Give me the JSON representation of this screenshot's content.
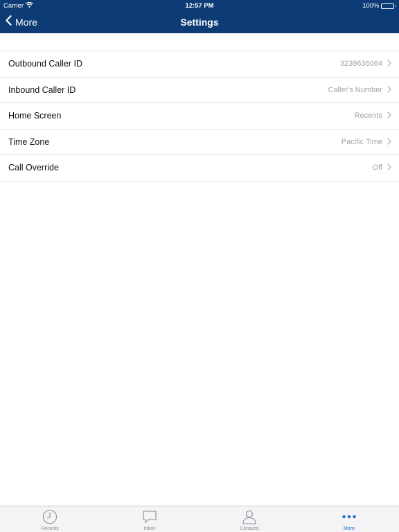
{
  "status_bar": {
    "carrier": "Carrier",
    "time": "12:57 PM",
    "battery": "100%",
    "battery_level": 1.0
  },
  "nav": {
    "back_label": "More",
    "title": "Settings"
  },
  "settings": {
    "items": [
      {
        "label": "Outbound Caller ID",
        "value": "3239636064"
      },
      {
        "label": "Inbound Caller ID",
        "value": "Caller's Number"
      },
      {
        "label": "Home Screen",
        "value": "Recents"
      },
      {
        "label": "Time Zone",
        "value": "Pacific Time"
      },
      {
        "label": "Call Override",
        "value": "Off"
      }
    ]
  },
  "tab_bar": {
    "tabs": [
      {
        "label": "Recents",
        "icon": "clock-icon",
        "active": false
      },
      {
        "label": "Inbox",
        "icon": "speech-bubble-icon",
        "active": false
      },
      {
        "label": "Contacts",
        "icon": "person-icon",
        "active": false
      },
      {
        "label": "More",
        "icon": "ellipsis-icon",
        "active": true
      }
    ]
  },
  "colors": {
    "header": "#0d3b76",
    "active_tab": "#1a70c8",
    "inactive_tab": "#8e8e93",
    "secondary_text": "#a3a3a8"
  }
}
